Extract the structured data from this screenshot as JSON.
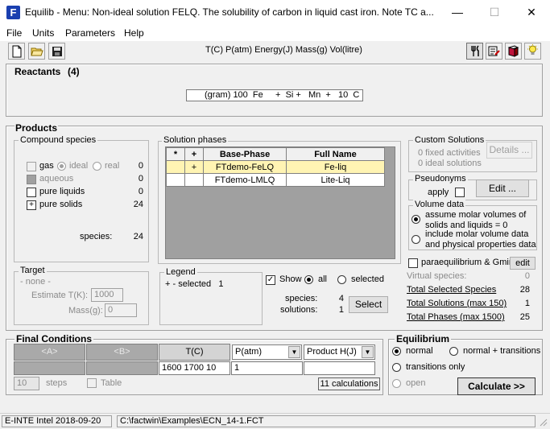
{
  "window": {
    "app_icon": "F",
    "title": "Equilib - Menu: Non-ideal solution FELQ.  The solubility of carbon in liquid cast iron.  Note TC a...",
    "minimize": "—",
    "maximize": "☐",
    "close": "✕"
  },
  "menu": [
    "File",
    "Units",
    "Parameters",
    "Help"
  ],
  "toolbar": {
    "units": "T(C)  P(atm)  Energy(J)  Mass(g)  Vol(litre)",
    "icons_left": [
      "new-file-icon",
      "open-folder-icon",
      "save-disk-icon"
    ],
    "icons_right": [
      "fork-knife-icon",
      "edit-list-icon",
      "book-icon",
      "lightbulb-icon"
    ]
  },
  "reactants": {
    "title": "Reactants",
    "count": "(4)",
    "expression": "(gram) 100  Fe     +  Si +   Mn  +   10  C"
  },
  "products": {
    "title": "Products",
    "compound_species": {
      "title": "Compound species",
      "gas_label": "gas",
      "ideal_label": "ideal",
      "real_label": "real",
      "gas_count": "0",
      "aqueous_label": "aqueous",
      "aqueous_count": "0",
      "pure_liquids_label": "pure liquids",
      "pure_liquids_count": "0",
      "pure_solids_mark": "+",
      "pure_solids_label": "pure solids",
      "pure_solids_count": "24",
      "species_label": "species:",
      "species_count": "24"
    },
    "target": {
      "title": "Target",
      "value": "- none -",
      "estimate_label": "Estimate T(K):",
      "estimate_value": "1000",
      "mass_label": "Mass(g):",
      "mass_value": "0"
    },
    "solution_phases": {
      "title": "Solution phases",
      "columns": [
        "*",
        "+",
        "Base-Phase",
        "Full Name"
      ],
      "rows": [
        {
          "star": "",
          "plus": "+",
          "base": "FTdemo-FeLQ",
          "full": "Fe-liq"
        },
        {
          "star": "",
          "plus": "",
          "base": "FTdemo-LMLQ",
          "full": "Lite-Liq"
        }
      ]
    },
    "legend": {
      "title": "Legend",
      "text": "+ - selected   1"
    },
    "show": {
      "label": "Show",
      "all_label": "all",
      "selected_label": "selected",
      "species_label": "species:",
      "species_value": "4",
      "solutions_label": "solutions:",
      "solutions_value": "1",
      "select_button": "Select"
    },
    "custom_solutions": {
      "title": "Custom Solutions",
      "fixed": "0  fixed activities",
      "ideal": "0  ideal solutions",
      "details_button": "Details ..."
    },
    "pseudonyms": {
      "title": "Pseudonyms",
      "apply_label": "apply",
      "edit_button": "Edit ..."
    },
    "volume_data": {
      "title": "Volume data",
      "opt1_line1": "assume molar volumes of",
      "opt1_line2": "solids and liquids = 0",
      "opt2_line1": "include molar volume data",
      "opt2_line2": "and physical properties data"
    },
    "paraequilibrium": {
      "label": "paraequilibrium & Gmin",
      "edit_button": "edit"
    },
    "totals": {
      "virtual_label": "Virtual species:",
      "virtual_value": "0",
      "selected_label": "Total Selected Species",
      "selected_value": "28",
      "solutions_label": "Total Solutions (max 150)",
      "solutions_value": "1",
      "phases_label": "Total Phases (max 1500)",
      "phases_value": "25"
    }
  },
  "final_conditions": {
    "title": "Final Conditions",
    "headers": [
      "<A>",
      "<B>",
      "T(C)"
    ],
    "pressure_header": "P(atm)",
    "product_header": "Product H(J)",
    "t_value": "1600 1700 10",
    "p_value": "1",
    "steps_value": "10",
    "steps_label": "steps",
    "table_label": "Table",
    "calculations": "11 calculations"
  },
  "equilibrium": {
    "title": "Equilibrium",
    "normal": "normal",
    "normal_transitions": "normal + transitions",
    "transitions_only": "transitions only",
    "open": "open",
    "calculate_button": "Calculate >>"
  },
  "status": {
    "version": "E-INTE Intel 2018-09-20",
    "path": "C:\\factwin\\Examples\\ECN_14-1.FCT"
  }
}
